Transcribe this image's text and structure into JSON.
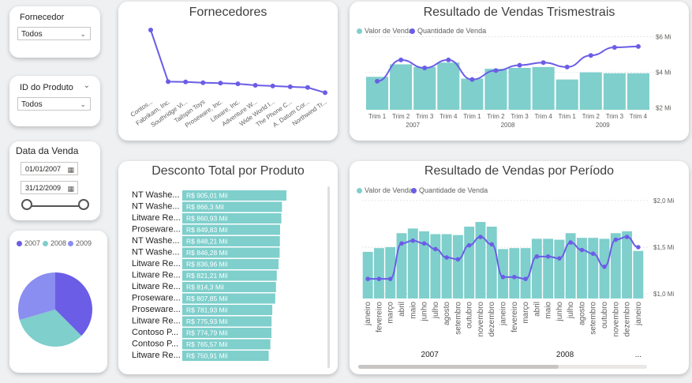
{
  "colors": {
    "teal": "#7fcfcc",
    "purple": "#6b5de6",
    "blue": "#8a8ef0",
    "label": "#605e5c"
  },
  "filters": {
    "fornecedor": {
      "label": "Fornecedor",
      "value": "Todos"
    },
    "produto": {
      "label": "ID do Produto",
      "value": "Todos"
    },
    "data": {
      "label": "Data da Venda",
      "start": "01/01/2007",
      "end": "31/12/2009"
    }
  },
  "fornecedores": {
    "title": "Fornecedores",
    "chart_data": {
      "type": "line",
      "categories": [
        "Contos...",
        "Fabrikam, Inc.",
        "Southridge Vi...",
        "Tailspin Toys",
        "Proseware, Inc.",
        "Litware, Inc.",
        "Adventure W...",
        "Wide World I...",
        "The Phone C...",
        "A. Datum Cor...",
        "Northwind Tr..."
      ],
      "values": [
        100,
        30,
        29.5,
        28.5,
        28,
        27,
        25,
        24,
        23,
        22,
        15
      ]
    }
  },
  "trimestrais": {
    "title": "Resultado de Vendas Trismestrais",
    "legend": [
      "Valor de Venda",
      "Quantidade de Venda"
    ],
    "y_ticks": [
      "$6 Mi",
      "$4 Mi",
      "$2 Mi"
    ],
    "years": [
      "2007",
      "2008",
      "2009"
    ],
    "chart_data": {
      "type": "bar+line",
      "categories": [
        "Trim 1",
        "Trim 2",
        "Trim 3",
        "Trim 4",
        "Trim 1",
        "Trim 2",
        "Trim 3",
        "Trim 4",
        "Trim 1",
        "Trim 2",
        "Trim 3",
        "Trim 4"
      ],
      "bar_values_mi": [
        3.75,
        4.45,
        4.3,
        4.55,
        3.65,
        4.2,
        4.25,
        4.3,
        3.6,
        4.0,
        3.95,
        3.95
      ],
      "line_values_mi": [
        3.5,
        4.7,
        4.25,
        4.7,
        3.6,
        4.1,
        4.4,
        4.55,
        4.3,
        4.95,
        5.4,
        5.45
      ],
      "ylim": [
        1.9,
        6.2
      ]
    }
  },
  "desconto": {
    "title": "Desconto Total por Produto",
    "chart_data": {
      "type": "bar",
      "categories": [
        "NT Washe...",
        "NT Washe...",
        "Litware Re...",
        "Proseware...",
        "NT Washe...",
        "NT Washe...",
        "Litware Re...",
        "Litware Re...",
        "Litware Re...",
        "Proseware...",
        "Proseware...",
        "Litware Re...",
        "Contoso P...",
        "Contoso P...",
        "Litware Re..."
      ],
      "values": [
        905.01,
        866.3,
        860.93,
        849.83,
        848.21,
        846.28,
        836.96,
        821.21,
        814.3,
        807.85,
        781.93,
        775.93,
        774.79,
        765.57,
        750.91
      ],
      "labels": [
        "R$ 905,01 Mil",
        "R$ 866,3 Mil",
        "R$ 860,93 Mil",
        "R$ 849,83 Mil",
        "R$ 848,21 Mil",
        "R$ 846,28 Mil",
        "R$ 836,96 Mil",
        "R$ 821,21 Mil",
        "R$ 814,3 Mil",
        "R$ 807,85 Mil",
        "R$ 781,93 Mil",
        "R$ 775,93 Mil",
        "R$ 774,79 Mil",
        "R$ 765,57 Mil",
        "R$ 750,91 Mil"
      ]
    }
  },
  "pie": {
    "legend": [
      "2007",
      "2008",
      "2009"
    ],
    "chart_data": {
      "type": "pie",
      "categories": [
        "2007",
        "2008",
        "2009"
      ],
      "values": [
        0.375,
        0.33,
        0.295
      ]
    }
  },
  "periodo": {
    "title": "Resultado de Vendas por Período",
    "legend": [
      "Valor de Venda",
      "Quantidade de Venda"
    ],
    "y_ticks": [
      "$2,0 Mi",
      "$1,5 Mi",
      "$1,0 Mi"
    ],
    "years": [
      "2007",
      "2008",
      "..."
    ],
    "chart_data": {
      "type": "bar+line",
      "categories": [
        "janeiro",
        "fevereiro",
        "março",
        "abril",
        "maio",
        "junho",
        "julho",
        "agosto",
        "setembro",
        "outubro",
        "novembro",
        "dezembro",
        "janeiro",
        "fevereiro",
        "março",
        "abril",
        "maio",
        "junho",
        "julho",
        "agosto",
        "setembro",
        "outubro",
        "novembro",
        "dezembro",
        "janeiro"
      ],
      "bar_values_mi": [
        1.45,
        1.49,
        1.5,
        1.65,
        1.7,
        1.67,
        1.64,
        1.64,
        1.63,
        1.72,
        1.77,
        1.72,
        1.48,
        1.49,
        1.49,
        1.59,
        1.59,
        1.58,
        1.65,
        1.6,
        1.6,
        1.59,
        1.65,
        1.67,
        1.46
      ],
      "line_values_mi": [
        1.16,
        1.16,
        1.16,
        1.54,
        1.57,
        1.54,
        1.48,
        1.39,
        1.37,
        1.52,
        1.61,
        1.53,
        1.18,
        1.18,
        1.16,
        1.4,
        1.4,
        1.38,
        1.55,
        1.47,
        1.43,
        1.29,
        1.58,
        1.61,
        1.5
      ],
      "ylim": [
        0.95,
        2.05
      ]
    }
  }
}
